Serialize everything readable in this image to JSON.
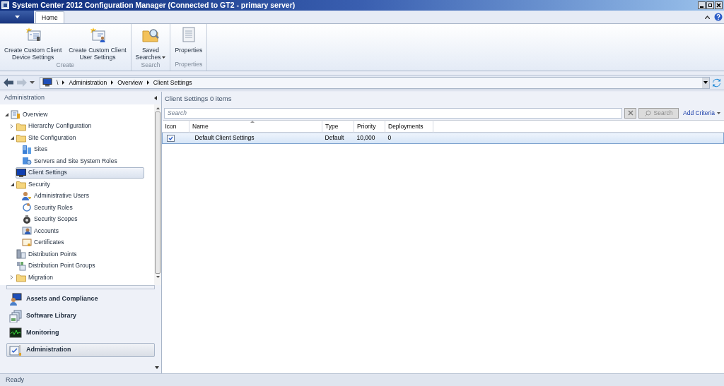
{
  "window": {
    "title": "System Center 2012 Configuration Manager (Connected to GT2 - primary server)"
  },
  "ribbon": {
    "tabs": [
      {
        "label": "Home",
        "selected": true
      }
    ],
    "groups": [
      {
        "label": "Create",
        "buttons": [
          {
            "kind": "device-settings",
            "lines": [
              "Create Custom Client",
              "Device Settings"
            ]
          },
          {
            "kind": "user-settings",
            "lines": [
              "Create Custom Client",
              "User Settings"
            ]
          }
        ]
      },
      {
        "label": "Search",
        "buttons": [
          {
            "kind": "saved-searches",
            "lines": [
              "Saved",
              "Searches"
            ],
            "dropdown": true
          }
        ]
      },
      {
        "label": "Properties",
        "buttons": [
          {
            "kind": "properties",
            "lines": [
              "Properties"
            ]
          }
        ]
      }
    ]
  },
  "breadcrumb": [
    "\\",
    "Administration",
    "Overview",
    "Client Settings"
  ],
  "navigation": {
    "title": "Administration",
    "tree": [
      {
        "label": "Overview",
        "kind": "overview",
        "expanded": true,
        "selected": false,
        "children": [
          {
            "label": "Hierarchy Configuration",
            "kind": "folder",
            "expanded": false,
            "selected": false
          },
          {
            "label": "Site Configuration",
            "kind": "folder",
            "expanded": true,
            "selected": false,
            "children": [
              {
                "label": "Sites",
                "kind": "sites",
                "selected": false
              },
              {
                "label": "Servers and Site System Roles",
                "kind": "servers",
                "selected": false
              }
            ]
          },
          {
            "label": "Client Settings",
            "kind": "client",
            "selected": true
          },
          {
            "label": "Security",
            "kind": "folder",
            "expanded": true,
            "selected": false,
            "children": [
              {
                "label": "Administrative Users",
                "kind": "users",
                "selected": false
              },
              {
                "label": "Security Roles",
                "kind": "roles",
                "selected": false
              },
              {
                "label": "Security Scopes",
                "kind": "scopes",
                "selected": false
              },
              {
                "label": "Accounts",
                "kind": "accounts",
                "selected": false
              },
              {
                "label": "Certificates",
                "kind": "certificates",
                "selected": false
              }
            ]
          },
          {
            "label": "Distribution Points",
            "kind": "dp",
            "selected": false
          },
          {
            "label": "Distribution Point Groups",
            "kind": "dpgroups",
            "selected": false
          },
          {
            "label": "Migration",
            "kind": "folder",
            "expanded": false,
            "selected": false
          }
        ]
      }
    ],
    "workspaces": [
      {
        "label": "Assets and Compliance",
        "kind": "assets",
        "selected": false
      },
      {
        "label": "Software Library",
        "kind": "library",
        "selected": false
      },
      {
        "label": "Monitoring",
        "kind": "monitoring",
        "selected": false
      },
      {
        "label": "Administration",
        "kind": "administration",
        "selected": true
      }
    ]
  },
  "list": {
    "title": "Client Settings 0 items",
    "search": {
      "placeholder": "Search",
      "button": "Search",
      "add_criteria": "Add Criteria"
    },
    "columns": [
      "Icon",
      "Name",
      "Type",
      "Priority",
      "Deployments"
    ],
    "rows": [
      {
        "name": "Default Client Settings",
        "type": "Default",
        "priority": "10,000",
        "deployments": "0",
        "selected": true
      }
    ]
  },
  "status_bar": "Ready"
}
